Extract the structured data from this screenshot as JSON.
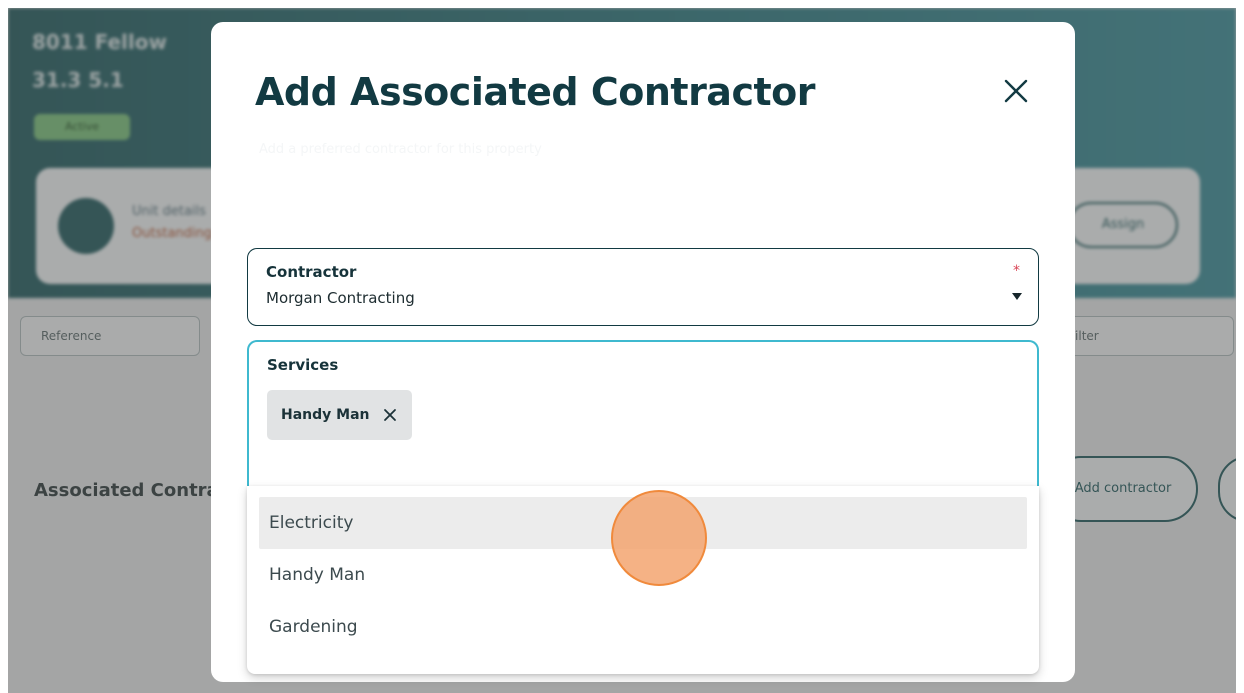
{
  "background": {
    "title": "8011 Fellow",
    "meta": "31.3   5.1",
    "badge": "Active",
    "card_text": "Unit details",
    "card_sub": "Outstanding",
    "card_pill": "Assign",
    "select_left": "Reference",
    "select_right": "Filter",
    "section_title": "Associated Contractors",
    "pill_button": "Add contractor"
  },
  "modal": {
    "title": "Add Associated Contractor",
    "subtitle": "Add a preferred contractor for this property",
    "close_icon": "close-icon",
    "contractor": {
      "label": "Contractor",
      "value": "Morgan Contracting",
      "required_marker": "*"
    },
    "services": {
      "label": "Services",
      "selected_chips": [
        {
          "label": "Handy Man"
        }
      ]
    },
    "dropdown": {
      "options": [
        {
          "label": "Electricity",
          "highlighted": true
        },
        {
          "label": "Handy Man",
          "highlighted": false
        },
        {
          "label": "Gardening",
          "highlighted": false
        }
      ]
    }
  },
  "colors": {
    "brand_dark": "#123a42",
    "focus_border": "#3fb9cf",
    "required": "#d94455",
    "cursor_marker": "#f08a3c"
  }
}
